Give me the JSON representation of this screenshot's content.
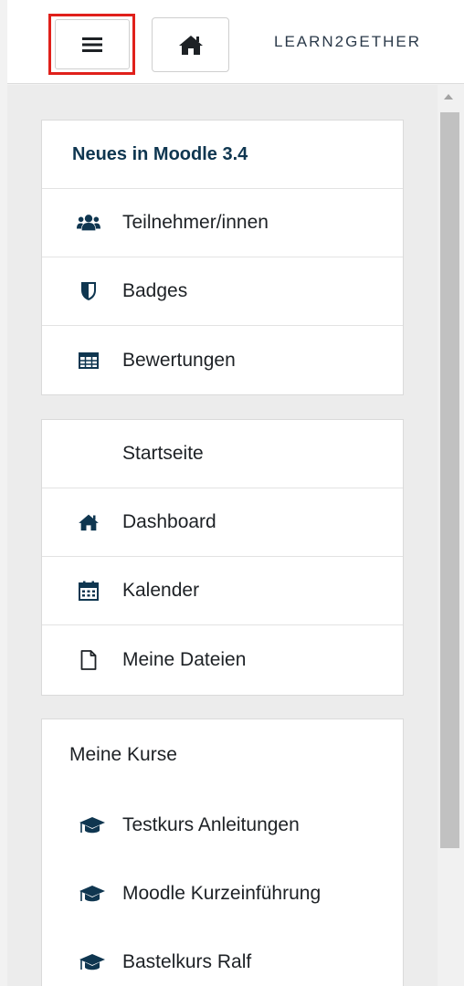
{
  "navbar": {
    "menu_icon": "hamburger-icon",
    "home_icon": "home-icon",
    "brand": "LEARN2GETHER"
  },
  "course_card": {
    "title": "Neues in Moodle 3.4",
    "items": [
      {
        "label": "Teilnehmer/innen",
        "icon": "users-icon"
      },
      {
        "label": "Badges",
        "icon": "shield-icon"
      },
      {
        "label": "Bewertungen",
        "icon": "table-icon"
      }
    ]
  },
  "site_card": {
    "items": [
      {
        "label": "Startseite",
        "icon": ""
      },
      {
        "label": "Dashboard",
        "icon": "home-icon"
      },
      {
        "label": "Kalender",
        "icon": "calendar-icon"
      },
      {
        "label": "Meine Dateien",
        "icon": "file-icon"
      }
    ]
  },
  "courses_card": {
    "title": "Meine Kurse",
    "items": [
      {
        "label": "Testkurs Anleitungen",
        "icon": "graduation-cap-icon"
      },
      {
        "label": "Moodle Kurzeinführung",
        "icon": "graduation-cap-icon"
      },
      {
        "label": "Bastelkurs Ralf",
        "icon": "graduation-cap-icon"
      }
    ]
  },
  "colors": {
    "highlight": "#e0201b",
    "icon": "#0f3650",
    "heading": "#0f3650"
  }
}
